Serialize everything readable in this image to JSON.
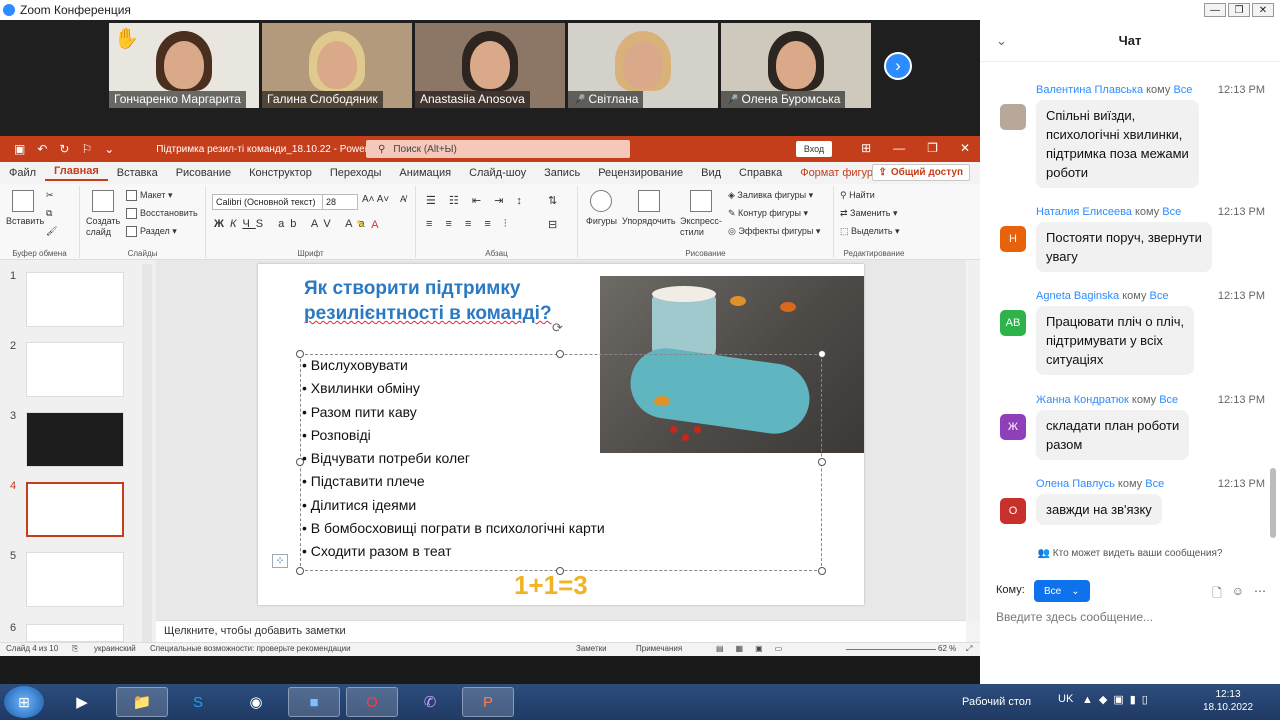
{
  "zoom": {
    "window_title": "Zoom Конференция",
    "participants": [
      {
        "name": "Гончаренко Маргарита",
        "muted": false,
        "hand_raised": true
      },
      {
        "name": "Галина Слободяник",
        "muted": false,
        "hand_raised": false
      },
      {
        "name": "Anastasiia Anosova",
        "muted": false,
        "hand_raised": false
      },
      {
        "name": "Світлана",
        "muted": true,
        "hand_raised": false
      },
      {
        "name": "Олена Буромська",
        "muted": true,
        "hand_raised": false
      }
    ],
    "next_icon": "chevron-right-icon"
  },
  "ppt": {
    "doc_title": "Підтримка резил-ті команди_18.10.22  -  PowerPoint",
    "search_placeholder": "Поиск (Alt+Ы)",
    "login": "Вход",
    "tabs": [
      "Файл",
      "Главная",
      "Вставка",
      "Рисование",
      "Конструктор",
      "Переходы",
      "Анимация",
      "Слайд-шоу",
      "Запись",
      "Рецензирование",
      "Вид",
      "Справка",
      "Формат фигуры"
    ],
    "active_tab": "Главная",
    "share": "Общий доступ",
    "ribbon": {
      "paste": "Вставить",
      "new_slide": "Создать слайд",
      "layout": "Макет",
      "reset": "Восстановить",
      "section": "Раздел",
      "font_name": "Calibri (Основной текст)",
      "font_size": "28",
      "shapes": "Фигуры",
      "arrange": "Упорядочить",
      "quick_styles": "Экспресс-стили",
      "fill": "Заливка фигуры",
      "outline": "Контур фигуры",
      "effects": "Эффекты фигуры",
      "find": "Найти",
      "replace": "Заменить",
      "select": "Выделить",
      "groups": {
        "clipboard": "Буфер обмена",
        "slides": "Слайды",
        "font": "Шрифт",
        "paragraph": "Абзац",
        "drawing": "Рисование",
        "editing": "Редактирование"
      }
    },
    "thumb_numbers": [
      "1",
      "2",
      "3",
      "4",
      "5",
      "6"
    ],
    "slide": {
      "title_line1": "Як створити підтримку",
      "title_line2": "резилієнтності в команді?",
      "bullets": [
        "Вислуховувати",
        "Хвилинки обміну",
        "Разом пити каву",
        "Розповіді",
        "Відчувати потреби колег",
        "Підставити плече",
        "Ділитися ідеями",
        "В бомбосховищі пограти в психологічні карти",
        "Сходити разом в теат"
      ],
      "formula": "1+1=3"
    },
    "notes_placeholder": "Щелкните, чтобы добавить заметки",
    "status": {
      "slide": "Слайд 4 из 10",
      "lang": "украинский",
      "accessibility": "Специальные возможности: проверьте рекомендации",
      "notes": "Заметки",
      "comments": "Примечания",
      "zoom": "62 %"
    }
  },
  "chat": {
    "title": "Чат",
    "to_word": "кому",
    "messages": [
      {
        "sender": "Валентина Плавська",
        "to": "Все",
        "time": "12:13 PM",
        "text": "Спільні виїзди,\nпсихологічні хвилинки,\nпідтримка поза межами\nроботи",
        "avatar": "",
        "color": "#b8a89a"
      },
      {
        "sender": "Наталия Елисеева",
        "to": "Все",
        "time": "12:13 PM",
        "text": "Постояти поруч, звернути\nувагу",
        "avatar": "Н",
        "color": "#e8620c"
      },
      {
        "sender": "Agneta Baginska",
        "to": "Все",
        "time": "12:13 PM",
        "text": "Працювати пліч о пліч,\nпідтримувати у всіх\nситуаціях",
        "avatar": "AB",
        "color": "#2eb24a"
      },
      {
        "sender": "Жанна Кондратюк",
        "to": "Все",
        "time": "12:13 PM",
        "text": "складати план роботи\nразом",
        "avatar": "Ж",
        "color": "#8f3fb8"
      },
      {
        "sender": "Олена Павлусь",
        "to": "Все",
        "time": "12:13 PM",
        "text": "завжди на зв'язку",
        "avatar": "О",
        "color": "#c7302b"
      }
    ],
    "who_sees": "Кто может видеть ваши сообщения?",
    "to_label": "Кому:",
    "to_value": "Все",
    "input_placeholder": "Введите здесь сообщение..."
  },
  "taskbar": {
    "desktop": "Рабочий стол",
    "lang": "UK",
    "time": "12:13",
    "date": "18.10.2022"
  }
}
